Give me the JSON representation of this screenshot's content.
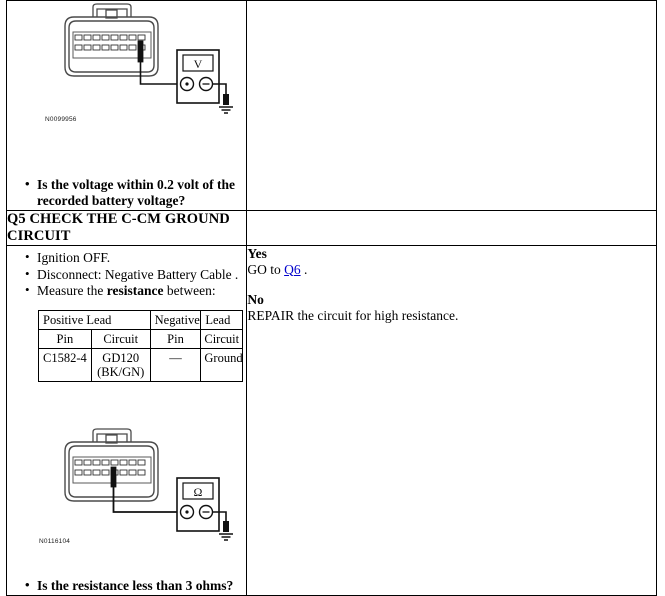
{
  "document": {
    "title": "Q5 CHECK THE C-CM GROUND CIRCUIT"
  },
  "top_section": {
    "figure_id": "N0099956",
    "meter_label": "V",
    "question": "Is the voltage within 0.2 volt of the recorded battery voltage?"
  },
  "step": {
    "header": "Q5 CHECK THE C-CM GROUND CIRCUIT",
    "actions": [
      "Ignition OFF.",
      "Disconnect: Negative Battery Cable .",
      "Measure the resistance between:"
    ],
    "action_bold_word": "resistance"
  },
  "measure_table": {
    "group_headers": [
      "Positive Lead",
      "Negative Lead"
    ],
    "group_header_parts": {
      "positive_a": "Positive",
      "positive_b": "Lead",
      "negative_a": "Negative",
      "negative_b": "Lead"
    },
    "column_headers": [
      "Pin",
      "Circuit",
      "Pin",
      "Circuit"
    ],
    "rows": [
      {
        "positive_pin": "C1582-4",
        "positive_circuit": "GD120 (BK/GN)",
        "positive_circuit_line1": "GD120",
        "positive_circuit_line2": "(BK/GN)",
        "negative_pin": "—",
        "negative_circuit": "Ground"
      }
    ]
  },
  "bottom_section": {
    "figure_id": "N0116104",
    "meter_label": "Ω",
    "question": "Is the resistance less than 3 ohms?"
  },
  "results": {
    "yes_label": "Yes",
    "yes_text_before": "GO to ",
    "yes_link": "Q6",
    "yes_text_after": " .",
    "no_label": "No",
    "no_text": "REPAIR the circuit for high resistance."
  },
  "colors": {
    "link": "#0000cc",
    "border": "#000000",
    "text": "#000000",
    "connector_outline": "#3a3a3a",
    "connector_fill": "#ffffff"
  }
}
